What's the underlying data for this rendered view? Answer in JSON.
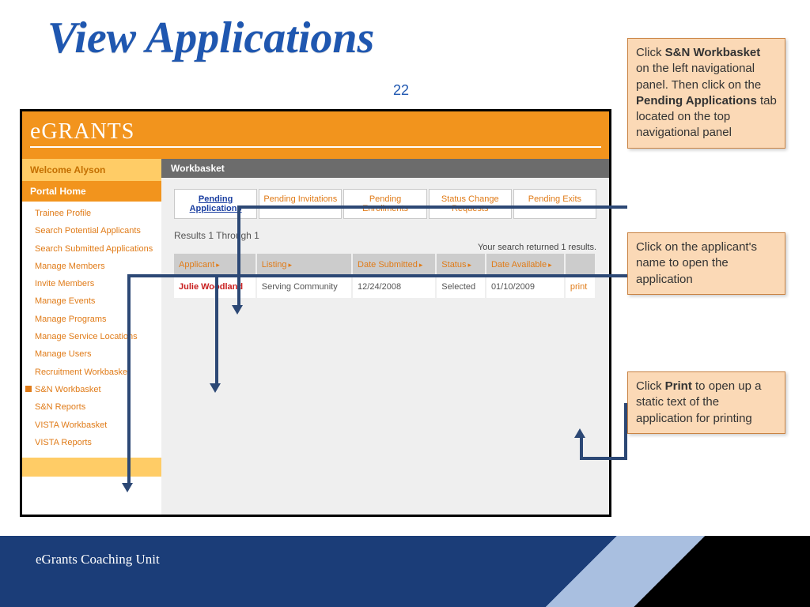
{
  "slide": {
    "title": "View Applications",
    "number": "22",
    "footer": "eGrants Coaching Unit"
  },
  "app": {
    "logo": "eGRANTS",
    "welcome": "Welcome Alyson",
    "portal_home": "Portal Home",
    "workbasket_label": "Workbasket"
  },
  "sidebar": {
    "items": [
      "Trainee Profile",
      "Search Potential Applicants",
      "Search Submitted Applications",
      "Manage Members",
      "Invite Members",
      "Manage Events",
      "Manage Programs",
      "Manage Service Locations",
      "Manage Users",
      "Recruitment Workbasket",
      "S&N Workbasket",
      "S&N Reports",
      "VISTA Workbasket",
      "VISTA Reports"
    ],
    "active_index": 10
  },
  "tabs": [
    "Pending Applications",
    "Pending Invitations",
    "Pending Enrollments",
    "Status Change Requests",
    "Pending Exits"
  ],
  "results": {
    "summary": "Results 1 Through 1",
    "count_text": "Your search returned 1 results.",
    "columns": [
      "Applicant",
      "Listing",
      "Date Submitted",
      "Status",
      "Date Available",
      ""
    ],
    "rows": [
      {
        "applicant": "Julie Woodland",
        "listing": "Serving Community",
        "date_submitted": "12/24/2008",
        "status": "Selected",
        "date_available": "01/10/2009",
        "action": "print"
      }
    ]
  },
  "callouts": {
    "c1_pre": "Click ",
    "c1_b1": "S&N Workbasket",
    "c1_mid": " on the left navigational panel. Then click on the ",
    "c1_b2": "Pending Applications",
    "c1_post": " tab located on the top navigational panel",
    "c2": "Click on the applicant's name to open the application",
    "c3_pre": "Click ",
    "c3_b": "Print",
    "c3_post": " to open up a static text of the application for printing"
  }
}
